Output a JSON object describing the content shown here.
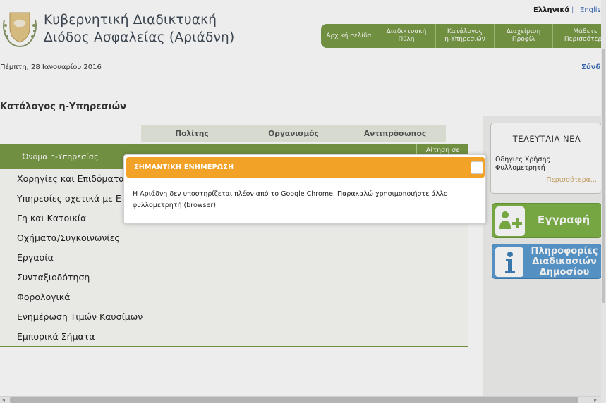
{
  "header": {
    "title_line1": "Κυβερνητική Διαδικτυακή",
    "title_line2": "Διόδος Ασφαλείας  (Αριάδνη)",
    "emblem_icon": "cyprus-coat-of-arms-icon"
  },
  "language": {
    "greek": "Ελληνικά",
    "separator": "|",
    "english": "Englis"
  },
  "topnav": {
    "items": [
      {
        "line1": "Αρχική σελίδα",
        "line2": ""
      },
      {
        "line1": "Διαδικτυακή",
        "line2": "Πύλη"
      },
      {
        "line1": "Κατάλογος",
        "line2": "η-Υπηρεσιών"
      },
      {
        "line1": "Διαχείριση",
        "line2": "Προφίλ"
      },
      {
        "line1": "Μάθετε",
        "line2": "Περισσότερα"
      }
    ],
    "color": "#7a9a46"
  },
  "date": "Πέμπτη, 28 Ιανουαρίου 2016",
  "login_link": "Σύνδ",
  "page_title": "Κατάλογος η-Υπηρεσιών",
  "catalogue": {
    "audiences": [
      "Πολίτης",
      "Οργανισμός",
      "Αντιπρόσωπος"
    ],
    "columns": [
      "Όνομα η-Υπηρεσίας",
      "",
      "",
      "",
      "Αίτηση σε"
    ],
    "categories": [
      "Χορηγίες και Επιδόματα",
      "Υπηρεσίες σχετικά με Ε",
      "Γη και Κατοικία",
      "Οχήματα/Συγκοινωνίες",
      "Εργασία",
      "Συνταξιοδότηση",
      "Φορολογικά",
      "Ενημέρωση Τιμών Καυσίμων",
      "Εμπορικά Σήματα"
    ]
  },
  "sidebar": {
    "news_title": "ΤΕΛΕΥΤΑΙΑ ΝΕΑ",
    "news_item_line1": "Οδηγίες Χρήσης",
    "news_item_line2": "Φυλλομετρητή",
    "news_more": "Περισσότερα...",
    "register_label": "Εγγραφή",
    "register_icon": "register-user-icon",
    "info_line1": "Πληροφορίες",
    "info_line2": "Διαδικασιών",
    "info_line3": "Δημοσίου",
    "info_icon": "info-icon"
  },
  "modal": {
    "title": "ΣΗΜΑΝΤΙΚΗ ΕΝΗΜΕΡΩΣΗ",
    "body_line1": "Η Αριάδνη δεν υποστηρίζεται πλέον από το Google Chrome. Παρακαλώ χρησιμοποιήστε άλλο",
    "body_line2": "φυλλομετρητή (browser).",
    "header_color": "#f3a228"
  },
  "scrollbar": {
    "left_arrow": "◂",
    "right_arrow": "▸"
  }
}
